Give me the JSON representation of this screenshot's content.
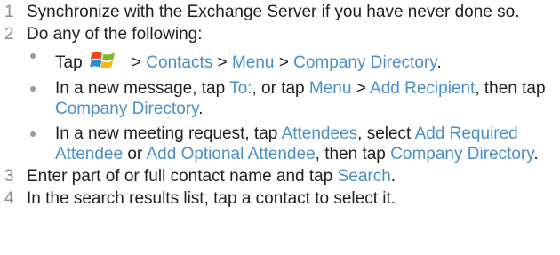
{
  "steps": [
    {
      "num": "1",
      "text": "Synchronize with the Exchange Server if you have never done so."
    },
    {
      "num": "2",
      "text": "Do any of the following:",
      "bullets": {
        "b1": {
          "tap": "Tap",
          "sep1": " > ",
          "contacts": "Contacts",
          "sep2": " > ",
          "menu": "Menu",
          "sep3": " > ",
          "company_directory": "Company Directory",
          "end": "."
        },
        "b2": {
          "t1": "In a new message, tap ",
          "to": "To:",
          "t2": ", or tap ",
          "menu": "Menu",
          "t3": " > ",
          "add_recipient": "Add Recipient",
          "t4": ", then tap ",
          "company_directory": "Company Directory",
          "end": "."
        },
        "b3": {
          "t1": "In a new meeting request, tap ",
          "attendees": "Attendees",
          "t2": ", select ",
          "add_required": "Add Required Attendee",
          "t3": " or ",
          "add_optional": "Add Optional Attendee",
          "t4": ", then tap ",
          "company_directory": "Company Directory",
          "end": "."
        }
      }
    },
    {
      "num": "3",
      "t1": "Enter part of or full contact name and tap ",
      "search": "Search",
      "end": "."
    },
    {
      "num": "4",
      "text": "In the search results list, tap a contact to select it."
    }
  ],
  "icons": {
    "start": "windows-start-icon"
  },
  "colors": {
    "link": "#4a8fc8",
    "text": "#1e1e1e",
    "step_number": "#8a8a8a",
    "bullet": "#9a9a9a"
  }
}
